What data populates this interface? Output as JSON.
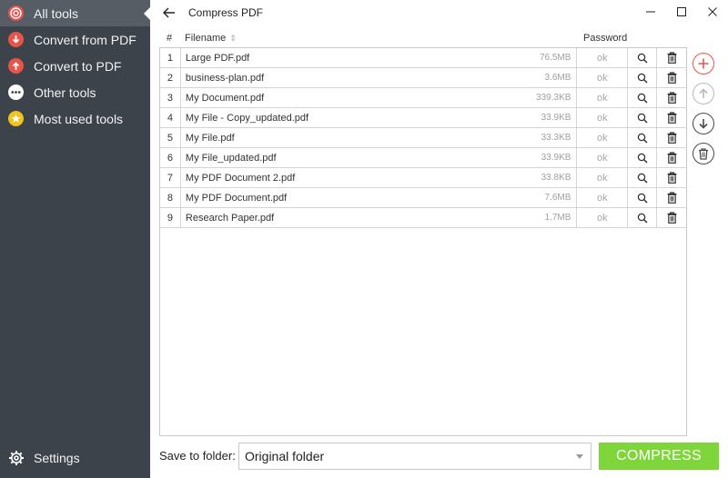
{
  "sidebar": {
    "items": [
      {
        "label": "All tools",
        "icon": "target-icon"
      },
      {
        "label": "Convert from PDF",
        "icon": "arrow-down-circle-icon"
      },
      {
        "label": "Convert to PDF",
        "icon": "arrow-up-circle-icon"
      },
      {
        "label": "Other tools",
        "icon": "ellipsis-icon"
      },
      {
        "label": "Most used tools",
        "icon": "star-icon"
      }
    ],
    "settings_label": "Settings"
  },
  "header": {
    "title": "Compress PDF"
  },
  "table": {
    "col_num": "#",
    "col_filename": "Filename",
    "col_password": "Password",
    "rows": [
      {
        "num": "1",
        "name": "Large PDF.pdf",
        "size": "76.5MB",
        "password": "ok"
      },
      {
        "num": "2",
        "name": "business-plan.pdf",
        "size": "3.6MB",
        "password": "ok"
      },
      {
        "num": "3",
        "name": "My Document.pdf",
        "size": "339.3KB",
        "password": "ok"
      },
      {
        "num": "4",
        "name": "My File - Copy_updated.pdf",
        "size": "33.9KB",
        "password": "ok"
      },
      {
        "num": "5",
        "name": "My File.pdf",
        "size": "33.3KB",
        "password": "ok"
      },
      {
        "num": "6",
        "name": "My File_updated.pdf",
        "size": "33.9KB",
        "password": "ok"
      },
      {
        "num": "7",
        "name": "My PDF Document 2.pdf",
        "size": "33.8KB",
        "password": "ok"
      },
      {
        "num": "8",
        "name": "My PDF Document.pdf",
        "size": "7.6MB",
        "password": "ok"
      },
      {
        "num": "9",
        "name": "Research Paper.pdf",
        "size": "1.7MB",
        "password": "ok"
      }
    ]
  },
  "bottom": {
    "save_label": "Save to folder:",
    "folder_value": "Original folder",
    "compress_label": "COMPRESS"
  },
  "colors": {
    "sidebar_bg": "#3d434b",
    "accent_red": "#e8534a",
    "compress_green": "#7ed63a"
  }
}
